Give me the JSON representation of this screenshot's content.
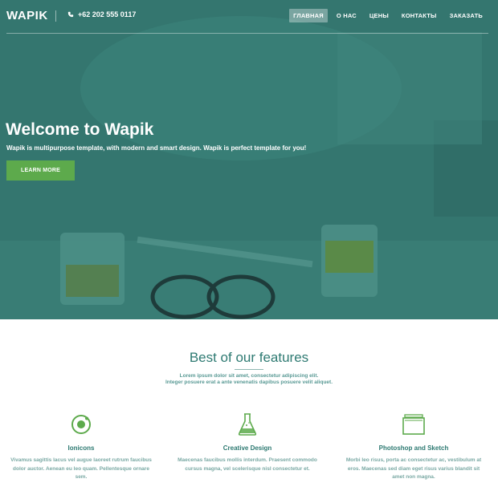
{
  "brand": "WAPIK",
  "phone": "+62 202 555 0117",
  "nav": [
    {
      "label": "ГЛАВНАЯ",
      "active": true
    },
    {
      "label": "О НАС",
      "active": false
    },
    {
      "label": "ЦЕНЫ",
      "active": false
    },
    {
      "label": "КОНТАКТЫ",
      "active": false
    },
    {
      "label": "ЗАКАЗАТЬ",
      "active": false
    }
  ],
  "hero": {
    "title": "Welcome to Wapik",
    "subtitle": "Wapik is multipurpose template, with modern and smart design. Wapik is perfect template for you!",
    "button": "LEARN MORE"
  },
  "features": {
    "title": "Best of our features",
    "desc_line1": "Lorem ipsum dolor sit amet, consectetur adipiscing elit.",
    "desc_line2": "Integer posuere erat a ante venenatis dapibus posuere velit aliquet.",
    "items": [
      {
        "icon": "ionicons-logo-icon",
        "title": "Ionicons",
        "text": "Vivamus sagittis lacus vel augue laoreet rutrum faucibus dolor auctor. Aenean eu leo quam. Pellentesque ornare sem."
      },
      {
        "icon": "flask-icon",
        "title": "Creative Design",
        "text": "Maecenas faucibus mollis interdum. Praesent commodo cursus magna, vel scelerisque nisl consectetur et."
      },
      {
        "icon": "layers-icon",
        "title": "Photoshop and Sketch",
        "text": "Morbi leo risus, porta ac consectetur ac, vestibulum at eros. Maecenas sed diam eget risus varius blandit sit amet non magna."
      }
    ]
  },
  "colors": {
    "accent": "#5daa4c",
    "teal": "#2e7a72"
  }
}
